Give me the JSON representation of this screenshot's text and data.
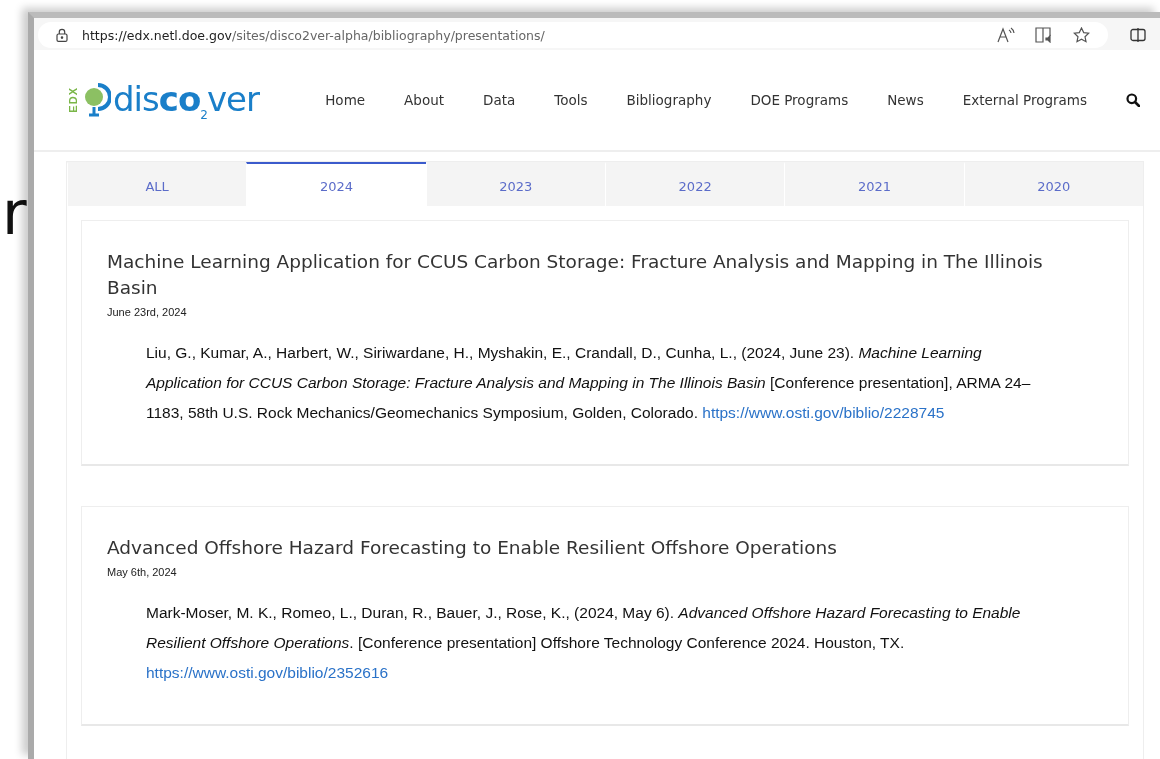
{
  "background": {
    "text": "r"
  },
  "browser": {
    "url_host": "https://edx.netl.doe.gov",
    "url_path": "/sites/disco2ver-alpha/bibliography/presentations/"
  },
  "site": {
    "logo": {
      "badge": "EDX",
      "name_start": "dis",
      "name_bold": "co",
      "name_sub": "2",
      "name_end": "ver"
    },
    "nav": [
      "Home",
      "About",
      "Data",
      "Tools",
      "Bibliography",
      "DOE Programs",
      "News",
      "External Programs"
    ]
  },
  "tabs": [
    {
      "label": "ALL",
      "selected": false
    },
    {
      "label": "2024",
      "selected": true
    },
    {
      "label": "2023",
      "selected": false
    },
    {
      "label": "2022",
      "selected": false
    },
    {
      "label": "2021",
      "selected": false
    },
    {
      "label": "2020",
      "selected": false
    }
  ],
  "entries": [
    {
      "title": "Machine Learning Application for CCUS Carbon Storage: Fracture Analysis and Mapping in The Illinois Basin",
      "date": "June 23rd, 2024",
      "citation": "Liu, G., Kumar, A., Harbert, W., Siriwardane, H., Myshakin, E., Crandall, D., Cunha, L., (2024, June 23). *Machine Learning Application for CCUS Carbon Storage: Fracture Analysis and Mapping in The Illinois Basin* [Conference presentation], ARMA 24–1183, 58th U.S. Rock Mechanics/Geomechanics Symposium, Golden, Colorado.",
      "link": "https://www.osti.gov/biblio/2228745"
    },
    {
      "title": "Advanced Offshore Hazard Forecasting to Enable Resilient Offshore Operations",
      "date": "May 6th, 2024",
      "citation": "Mark-Moser, M. K., Romeo, L., Duran, R., Bauer, J., Rose, K., (2024, May 6). *Advanced Offshore Hazard Forecasting to Enable Resilient Offshore Operations*. [Conference presentation] Offshore Technology Conference 2024. Houston, TX.",
      "link": "https://www.osti.gov/biblio/2352616"
    }
  ]
}
